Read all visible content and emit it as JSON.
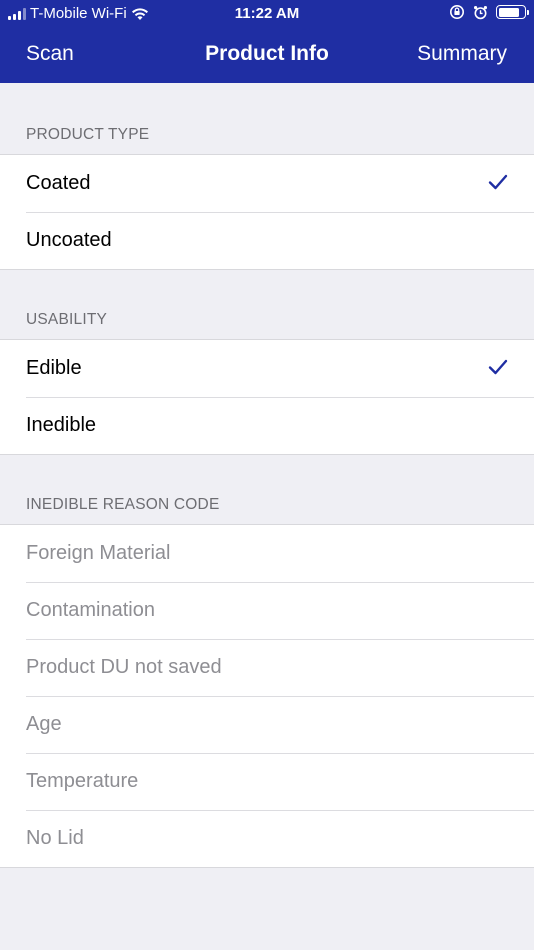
{
  "status_bar": {
    "carrier": "T-Mobile Wi-Fi",
    "time": "11:22 AM",
    "icons": [
      "signal-icon",
      "wifi-icon",
      "orientation-lock-icon",
      "alarm-icon",
      "battery-icon"
    ]
  },
  "nav": {
    "left_label": "Scan",
    "title": "Product Info",
    "right_label": "Summary"
  },
  "colors": {
    "nav_bg": "#1f2ea3",
    "check": "#1f2ea3",
    "background": "#efeff4",
    "disabled_text": "#8e8e93"
  },
  "sections": [
    {
      "header": "PRODUCT TYPE",
      "rows": [
        {
          "label": "Coated",
          "selected": true
        },
        {
          "label": "Uncoated",
          "selected": false
        }
      ]
    },
    {
      "header": "USABILITY",
      "rows": [
        {
          "label": "Edible",
          "selected": true
        },
        {
          "label": "Inedible",
          "selected": false
        }
      ]
    },
    {
      "header": "INEDIBLE REASON CODE",
      "disabled": true,
      "rows": [
        {
          "label": "Foreign Material",
          "selected": false
        },
        {
          "label": "Contamination",
          "selected": false
        },
        {
          "label": "Product DU not saved",
          "selected": false
        },
        {
          "label": "Age",
          "selected": false
        },
        {
          "label": "Temperature",
          "selected": false
        },
        {
          "label": "No Lid",
          "selected": false
        }
      ]
    }
  ]
}
